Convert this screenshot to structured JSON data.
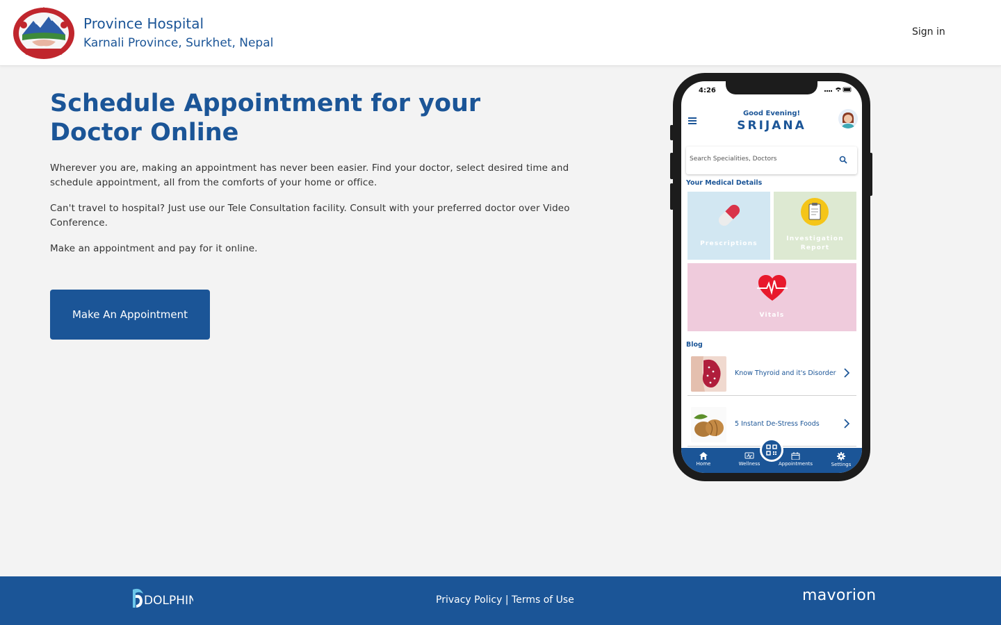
{
  "header": {
    "title": "Province Hospital",
    "subtitle": "Karnali Province, Surkhet, Nepal",
    "signin_label": "Sign in"
  },
  "hero": {
    "title": "Schedule Appointment for your Doctor Online",
    "paragraphs": [
      "Wherever you are, making an appointment has never been easier. Find your doctor, select desired time and schedule appointment, all from the comforts of your home or office.",
      "Can't travel to hospital? Just use our Tele Consultation facility. Consult with your preferred doctor over Video Conference.",
      "Make an appointment and pay for it online."
    ],
    "cta_label": "Make An Appointment"
  },
  "phone": {
    "time": "4:26",
    "greeting": "Good Evening!",
    "user_name": "SRIJANA",
    "search_placeholder": "Search Specialities, Doctors",
    "medical_section_title": "Your Medical Details",
    "tiles": [
      "Prescriptions",
      "Investigation Report",
      "Vitals"
    ],
    "blog_section_title": "Blog",
    "blog_items": [
      "Know Thyroid and it's Disorder",
      "5 Instant De-Stress Foods"
    ],
    "nav": [
      "Home",
      "Wellness",
      "Appointments",
      "Settings"
    ]
  },
  "footer": {
    "left_logo": "DOLPHIN",
    "privacy_label": "Privacy Policy",
    "separator": "|",
    "terms_label": "Terms of Use",
    "right_logo": "mavorion"
  },
  "colors": {
    "brand_blue": "#1b5597",
    "page_bg": "#f3f3f3",
    "tile_prescriptions": "#d2e7f2",
    "tile_investigation": "#dde9d2",
    "tile_vitals": "#efcbdc"
  }
}
